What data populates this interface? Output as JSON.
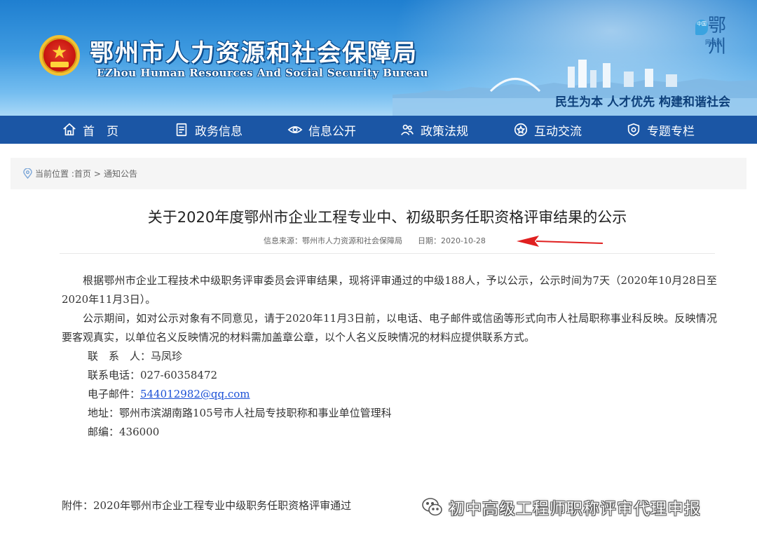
{
  "header": {
    "title": "鄂州市人力资源和社会保障局",
    "subtitle": "EZhou Human Resources And Social Security Bureau",
    "slogan": "民生为本 人才优先 构建和谐社会",
    "corner_logo": {
      "badge": "中国",
      "chars": "鄂州",
      "small": "网站群"
    }
  },
  "nav": {
    "items": [
      {
        "label": "首　页",
        "icon": "home-icon"
      },
      {
        "label": "政务信息",
        "icon": "document-icon"
      },
      {
        "label": "信息公开",
        "icon": "eye-icon"
      },
      {
        "label": "政策法规",
        "icon": "people-icon"
      },
      {
        "label": "互动交流",
        "icon": "star-icon"
      },
      {
        "label": "专题专栏",
        "icon": "shield-icon"
      }
    ]
  },
  "breadcrumb": {
    "prefix": "当前位置 :",
    "home": "首页",
    "separator": ">",
    "current": "通知公告"
  },
  "article": {
    "title": "关于2020年度鄂州市企业工程专业中、初级职务任职资格评审结果的公示",
    "source": "信息来源：鄂州市人力资源和社会保障局",
    "date": "日期：2020-10-28",
    "paragraphs": [
      "根据鄂州市企业工程技术中级职务评审委员会评审结果，现将评审通过的中级188人，予以公示，公示时间为7天（2020年10月28日至2020年11月3日）。",
      "公示期间，如对公示对象有不同意见，请于2020年11月3日前，以电话、电子邮件或信函等形式向市人社局职称事业科反映。反映情况要客观真实，以单位名义反映情况的材料需加盖章公章，以个人名义反映情况的材料应提供联系方式。"
    ],
    "contact": {
      "person_label": "联　系　人：",
      "person": "马凤珍",
      "phone_label": "联系电话：",
      "phone": "027-60358472",
      "email_label": "电子邮件：",
      "email": "544012982@qq.com",
      "address_label": "地址：",
      "address": "鄂州市滨湖南路105号市人社局专技职称和事业单位管理科",
      "postcode_label": "邮编：",
      "postcode": "436000"
    },
    "attachment": "附件：2020年鄂州市企业工程专业中级职务任职资格评审通过"
  },
  "watermark": "初中高级工程师职称评审代理申报",
  "colors": {
    "nav_bg": "#1b56a5",
    "banner_top": "#1f7fd0",
    "slogan": "#0c3f7a",
    "link": "#1a4fd6",
    "arrow": "#e02020"
  }
}
